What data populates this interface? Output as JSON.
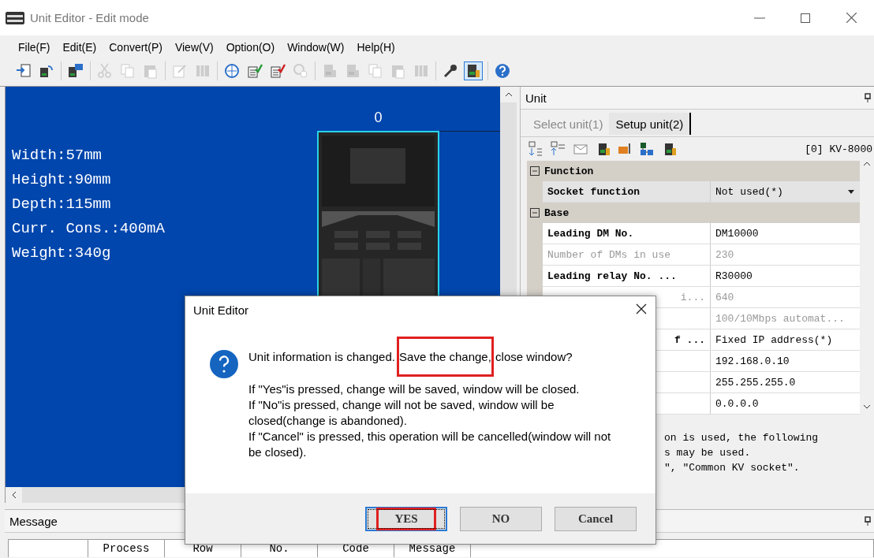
{
  "window": {
    "title": "Unit Editor - Edit mode"
  },
  "menu": [
    "File(F)",
    "Edit(E)",
    "Convert(P)",
    "View(V)",
    "Option(O)",
    "Window(W)",
    "Help(H)"
  ],
  "toolbar": [
    [
      {
        "kind": "import",
        "disabled": false
      },
      {
        "kind": "undo",
        "disabled": false
      }
    ],
    [
      {
        "kind": "transfer",
        "disabled": false
      }
    ],
    [
      {
        "kind": "scissors",
        "disabled": true
      },
      {
        "kind": "copy",
        "disabled": true
      },
      {
        "kind": "paste",
        "disabled": true
      }
    ],
    [
      {
        "kind": "edit",
        "disabled": true
      },
      {
        "kind": "grid",
        "disabled": true
      }
    ],
    [
      {
        "kind": "globe",
        "disabled": false
      },
      {
        "kind": "check-green",
        "disabled": false
      },
      {
        "kind": "check-red",
        "disabled": false
      },
      {
        "kind": "gear",
        "disabled": true
      }
    ],
    [
      {
        "kind": "unit",
        "disabled": true
      },
      {
        "kind": "unit",
        "disabled": true
      },
      {
        "kind": "copy",
        "disabled": true
      },
      {
        "kind": "paste",
        "disabled": true
      },
      {
        "kind": "grid",
        "disabled": true
      }
    ],
    [
      {
        "kind": "wrench",
        "disabled": false
      },
      {
        "kind": "unit",
        "disabled": false,
        "on": true
      }
    ],
    [
      {
        "kind": "help",
        "disabled": false
      }
    ]
  ],
  "layout_pane": {
    "slot_label": "0",
    "specs": [
      "Width:57mm",
      "Height:90mm",
      "Depth:115mm",
      "Curr. Cons.:400mA",
      "Weight:340g"
    ]
  },
  "unit_panel": {
    "title": "Unit",
    "tabs": [
      {
        "label": "Select unit(1)",
        "selected": false
      },
      {
        "label": "Setup unit(2)",
        "selected": true
      }
    ],
    "tool_icons": [
      {
        "kind": "sort-down"
      },
      {
        "kind": "sort-up"
      },
      {
        "kind": "mail"
      },
      {
        "kind": "unit"
      },
      {
        "kind": "ftp"
      },
      {
        "kind": "network"
      },
      {
        "kind": "unit"
      }
    ],
    "model": "[0] KV-8000",
    "sections": [
      {
        "title": "Function",
        "expanded": true,
        "rows": [
          {
            "kind": "dropdown",
            "label": "Socket function",
            "value": "Not used(*)",
            "disabled": false,
            "label_cut": false
          }
        ]
      },
      {
        "title": "Base",
        "expanded": true,
        "rows": [
          {
            "kind": "text",
            "label": "Leading DM No.",
            "value": "DM10000",
            "disabled": false,
            "label_cut": false
          },
          {
            "kind": "text",
            "label": "Number of DMs in use",
            "value": "230",
            "disabled": true,
            "label_cut": false
          },
          {
            "kind": "text",
            "label": "Leading relay No. ...",
            "value": "R30000",
            "disabled": false,
            "label_cut": false
          },
          {
            "kind": "text",
            "label": "i...",
            "value": "640",
            "disabled": true,
            "label_cut": true
          },
          {
            "kind": "text",
            "value": "100/10Mbps automat...",
            "disabled": true
          },
          {
            "kind": "text",
            "label": "f ...",
            "value": "Fixed IP address(*)",
            "disabled": false,
            "label_cut": true
          },
          {
            "kind": "text",
            "value": "192.168.0.10",
            "disabled": false
          },
          {
            "kind": "text",
            "value": "255.255.255.0",
            "disabled": false
          },
          {
            "kind": "text",
            "value": "0.0.0.0",
            "disabled": false
          }
        ]
      }
    ],
    "description": [
      "on is used, the following",
      "s may be used.",
      "\", \"Common KV socket\"."
    ]
  },
  "message_panel": {
    "title": "Message",
    "columns": [
      "Process",
      "Row",
      "No.",
      "Code",
      "Message"
    ]
  },
  "dialog": {
    "title": "Unit Editor",
    "question": [
      {
        "text": "Unit information is changed.",
        "highlighted": false
      },
      {
        "text": "Save the change,",
        "highlighted": true
      },
      {
        "text": "close window?",
        "highlighted": false
      }
    ],
    "details": [
      "If \"Yes\"is pressed, change will be saved, window will be closed.",
      "If \"No\"is pressed, change will not be saved, window will be closed(change is abandoned).",
      "If \"Cancel\" is pressed, this operation will be cancelled(window will not be closed)."
    ],
    "buttons": [
      {
        "label": "YES",
        "focused": true,
        "highlighted": true
      },
      {
        "label": "NO",
        "focused": false,
        "highlighted": false
      },
      {
        "label": "Cancel",
        "focused": false,
        "highlighted": false
      }
    ]
  }
}
